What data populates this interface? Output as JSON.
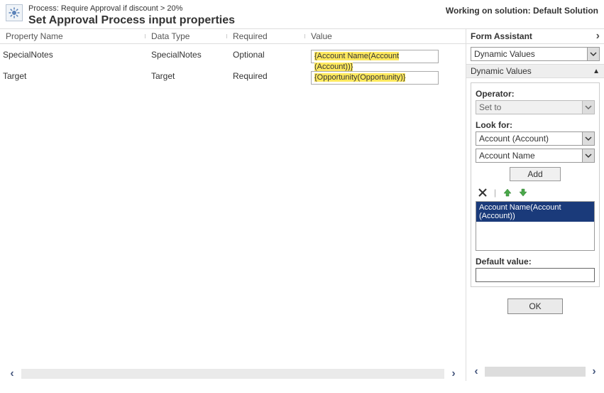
{
  "header": {
    "subtitle": "Process: Require Approval if discount > 20%",
    "title": "Set Approval Process input properties",
    "working_on": "Working on solution: Default Solution"
  },
  "table": {
    "headers": {
      "name": "Property Name",
      "type": "Data Type",
      "required": "Required",
      "value": "Value"
    },
    "rows": [
      {
        "name": "SpecialNotes",
        "type": "SpecialNotes",
        "required": "Optional",
        "value": "{Account Name(Account (Account))}"
      },
      {
        "name": "Target",
        "type": "Target",
        "required": "Required",
        "value": "{Opportunity(Opportunity)}"
      }
    ]
  },
  "form_assistant": {
    "title": "Form Assistant",
    "top_select": "Dynamic Values",
    "section_title": "Dynamic Values",
    "operator_label": "Operator:",
    "operator_value": "Set to",
    "lookfor_label": "Look for:",
    "lookfor_entity": "Account (Account)",
    "lookfor_attr": "Account Name",
    "add_label": "Add",
    "list_selected": "Account Name(Account (Account))",
    "default_label": "Default value:",
    "default_value": "",
    "ok_label": "OK"
  }
}
